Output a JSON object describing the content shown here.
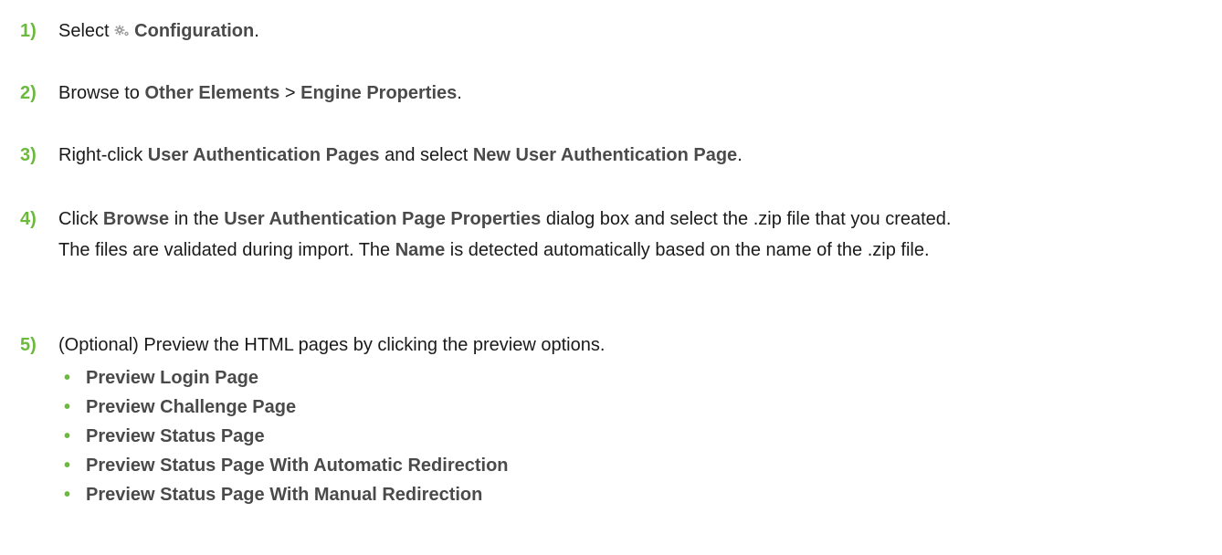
{
  "steps": [
    {
      "number": "1)",
      "parts": [
        "Select ",
        "Configuration",
        "."
      ],
      "icon": "gear-icon"
    },
    {
      "number": "2)",
      "parts": [
        "Browse to ",
        "Other Elements",
        " > ",
        "Engine Properties",
        "."
      ]
    },
    {
      "number": "3)",
      "parts": [
        "Right-click ",
        "User Authentication Pages",
        " and select ",
        "New User Authentication Page",
        "."
      ]
    },
    {
      "number": "4)",
      "parts": [
        "Click ",
        "Browse",
        " in the ",
        "User Authentication Page Properties",
        " dialog box and select the .zip file that you created."
      ],
      "note_parts": [
        "The files are validated during import. The ",
        "Name",
        " is detected automatically based on the name of the .zip file."
      ]
    },
    {
      "number": "5)",
      "text": "(Optional) Preview the HTML pages by clicking the preview options.",
      "bullet_marker": "•",
      "bullets": [
        "Preview Login Page",
        "Preview Challenge Page",
        "Preview Status Page",
        "Preview Status Page With Automatic Redirection",
        "Preview Status Page With Manual Redirection"
      ]
    }
  ],
  "colors": {
    "accent_green": "#6cba3c",
    "emphasis_gray": "#4a4a4a",
    "text": "#1a1a1a"
  }
}
